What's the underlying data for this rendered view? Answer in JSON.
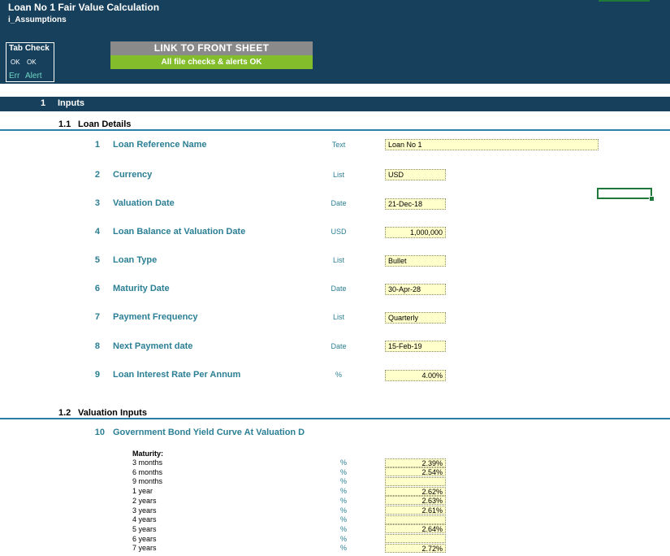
{
  "header": {
    "title": "Loan No 1 Fair Value Calculation",
    "subtitle": "i_Assumptions"
  },
  "tab_check": {
    "title": "Tab Check",
    "ok_1": "OK",
    "ok_2": "OK",
    "err": "Err",
    "alert": "Alert"
  },
  "link_button": {
    "label": "LINK TO FRONT SHEET",
    "status": "All file checks & alerts OK"
  },
  "section": {
    "num": "1",
    "title": "Inputs"
  },
  "loan_details": {
    "num": "1.1",
    "title": "Loan Details",
    "rows": [
      {
        "num": "1",
        "label": "Loan Reference Name",
        "type": "Text",
        "value": "Loan No 1"
      },
      {
        "num": "2",
        "label": "Currency",
        "type": "List",
        "value": "USD"
      },
      {
        "num": "3",
        "label": "Valuation Date",
        "type": "Date",
        "value": "21-Dec-18"
      },
      {
        "num": "4",
        "label": "Loan Balance at Valuation Date",
        "type": "USD",
        "value": "1,000,000"
      },
      {
        "num": "5",
        "label": "Loan Type",
        "type": "List",
        "value": "Bullet"
      },
      {
        "num": "6",
        "label": "Maturity Date",
        "type": "Date",
        "value": "30-Apr-28"
      },
      {
        "num": "7",
        "label": "Payment Frequency",
        "type": "List",
        "value": "Quarterly"
      },
      {
        "num": "8",
        "label": "Next Payment date",
        "type": "Date",
        "value": "15-Feb-19"
      },
      {
        "num": "9",
        "label": "Loan Interest Rate Per Annum",
        "type": "%",
        "value": "4.00%"
      }
    ]
  },
  "valuation_inputs": {
    "num": "1.2",
    "title": "Valuation Inputs",
    "row_num": "10",
    "row_label": "Government Bond Yield Curve At Valuation D",
    "maturity_header": "Maturity:",
    "curve": [
      {
        "label": "3 months",
        "unit": "%",
        "value": "2.39%"
      },
      {
        "label": "6 months",
        "unit": "%",
        "value": "2.54%"
      },
      {
        "label": "9 months",
        "unit": "%",
        "value": ""
      },
      {
        "label": "1 year",
        "unit": "%",
        "value": "2.62%"
      },
      {
        "label": "2 years",
        "unit": "%",
        "value": "2.63%"
      },
      {
        "label": "3 years",
        "unit": "%",
        "value": "2.61%"
      },
      {
        "label": "4 years",
        "unit": "%",
        "value": ""
      },
      {
        "label": "5 years",
        "unit": "%",
        "value": "2.64%"
      },
      {
        "label": "6 years",
        "unit": "%",
        "value": ""
      },
      {
        "label": "7 years",
        "unit": "%",
        "value": "2.72%"
      }
    ]
  },
  "colors": {
    "header_bg": "#17405c",
    "accent_teal": "#2b7f94",
    "input_fill": "#ffffcc",
    "status_green": "#84bd2c",
    "button_grey": "#8a8a8a"
  }
}
